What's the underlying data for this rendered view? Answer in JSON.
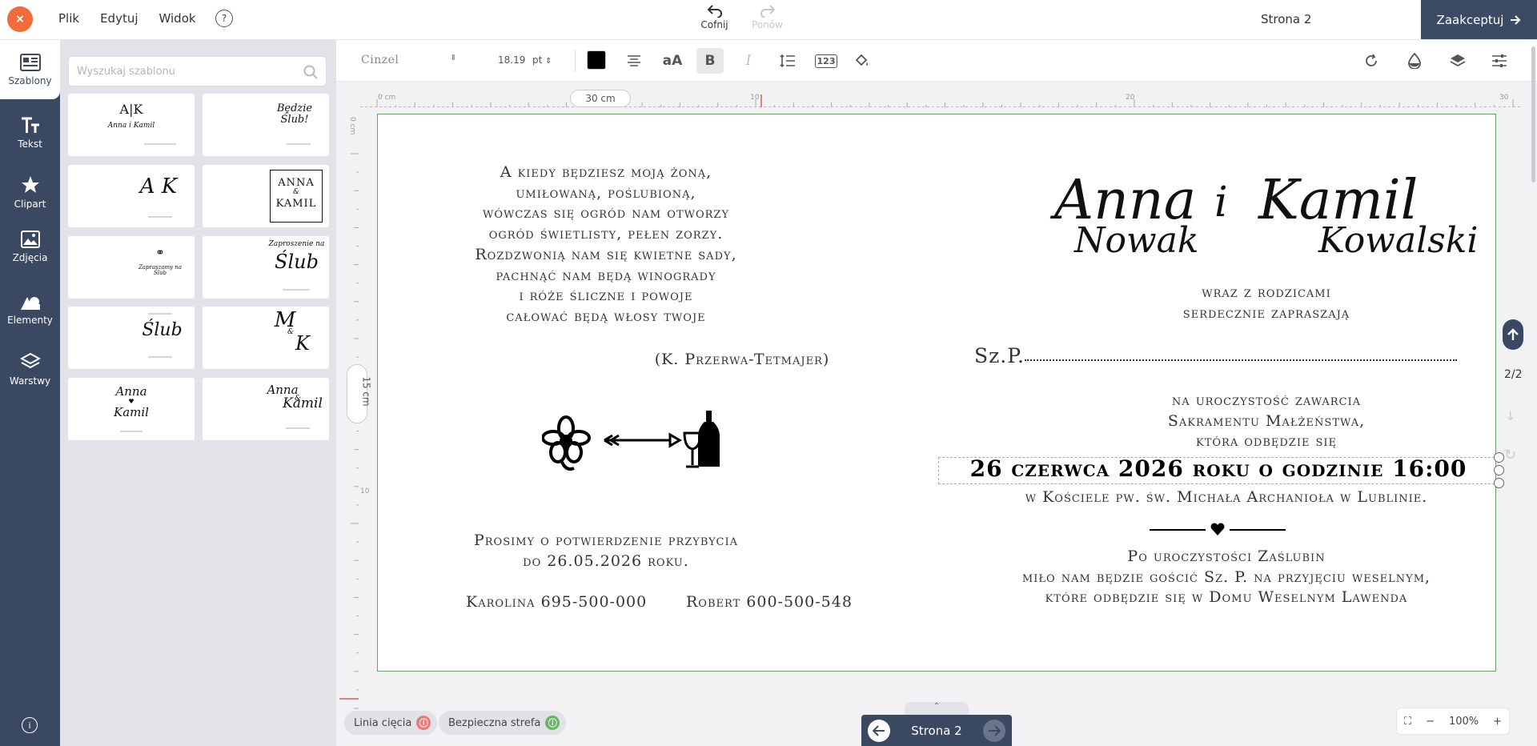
{
  "topbar": {
    "close": "×",
    "menu": [
      "Plik",
      "Edytuj",
      "Widok"
    ],
    "help": "?",
    "undo": "Cofnij",
    "redo": "Ponów",
    "page": "Strona 2",
    "accept": "Zaakceptuj"
  },
  "nav": {
    "items": [
      {
        "label": "Szablony",
        "icon": "templates-icon"
      },
      {
        "label": "Tekst",
        "icon": "text-icon"
      },
      {
        "label": "Clipart",
        "icon": "star-icon"
      },
      {
        "label": "Zdjęcia",
        "icon": "image-icon"
      },
      {
        "label": "Elementy",
        "icon": "shapes-icon"
      },
      {
        "label": "Warstwy",
        "icon": "layers-icon"
      }
    ],
    "info": "i"
  },
  "panel": {
    "search_placeholder": "Wyszukaj szablonu",
    "templates": [
      {
        "mono": "A|K",
        "sub": "Anna i Kamil"
      },
      {
        "mono": "Będzie Ślub!",
        "sub": ""
      },
      {
        "mono": "A K",
        "sub": ""
      },
      {
        "mono": "ANNA",
        "mono2": "KAMIL",
        "amp": "&"
      },
      {
        "mono": "Zapraszamy na Ślub",
        "sub": ""
      },
      {
        "mono": "Zaproszenie na",
        "mono2": "Ślub",
        "sub": ""
      },
      {
        "mono": "Ślub",
        "sub": ""
      },
      {
        "mono": "M",
        "mono2": "K",
        "amp": "&"
      },
      {
        "mono": "Anna",
        "mono2": "Kamil",
        "amp": "♥"
      },
      {
        "mono": "Anna",
        "mono2": "Kamil",
        "amp": "&"
      }
    ]
  },
  "toolbar": {
    "font": "Cinzel",
    "size": "18.19",
    "unit": "pt",
    "color": "#000000"
  },
  "rulers": {
    "top": [
      "0 cm",
      "10",
      "20",
      "30"
    ],
    "left": [
      "0 cm",
      "10"
    ],
    "width_badge": "30 cm",
    "height_badge": "15 cm"
  },
  "canvas": {
    "poem": [
      "A kiedy będziesz moją żoną,",
      "umiłowaną, poślubioną,",
      "wówczas się ogród nam otworzy",
      "ogród świetlisty, pełen zorzy.",
      "Rozdzwonią nam się kwietne sady,",
      "pachnąć nam będą winogrady",
      "i róże śliczne i powoje",
      "całować będą włosy twoje"
    ],
    "author": "(K. Przerwa-Tetmajer)",
    "rsvp": [
      "Prosimy o potwierdzenie przybycia",
      "do 26.05.2026 roku."
    ],
    "contact1": "Karolina 695-500-000",
    "contact2": "Robert 600-500-548",
    "name_first1": "Anna",
    "name_and": "i",
    "name_first2": "Kamil",
    "name_last1": "Nowak",
    "name_last2": "Kowalski",
    "parents": [
      "wraz z rodzicami",
      "serdecznie zapraszają"
    ],
    "guest": "Sz.P. ",
    "ceremony": [
      "na uroczystość zawarcia",
      "Sakramentu Małżeństwa,",
      "która odbędzie się"
    ],
    "date": "26 czerwca 2026 roku o godzinie 16:00",
    "church": "w Kościele pw. św. Michała Archanioła w Lublinie.",
    "reception": [
      "Po uroczystości Zaślubin",
      "miło nam będzie gościć Sz. P. na przyjęciu weselnym,",
      "które odbędzie się w Domu Weselnym Lawenda"
    ]
  },
  "side": {
    "page_count": "2/2"
  },
  "bottom": {
    "cut_line": "Linia cięcia",
    "safe_zone": "Bezpieczna strefa",
    "pager_label": "Strona 2",
    "zoom": "100%"
  },
  "colors": {
    "accent_dark": "#3b4861",
    "close_orange": "#f26b3a",
    "cut_red": "#e87a7a",
    "safe_green": "#6ab36a",
    "canvas_border": "#6aa06a"
  }
}
